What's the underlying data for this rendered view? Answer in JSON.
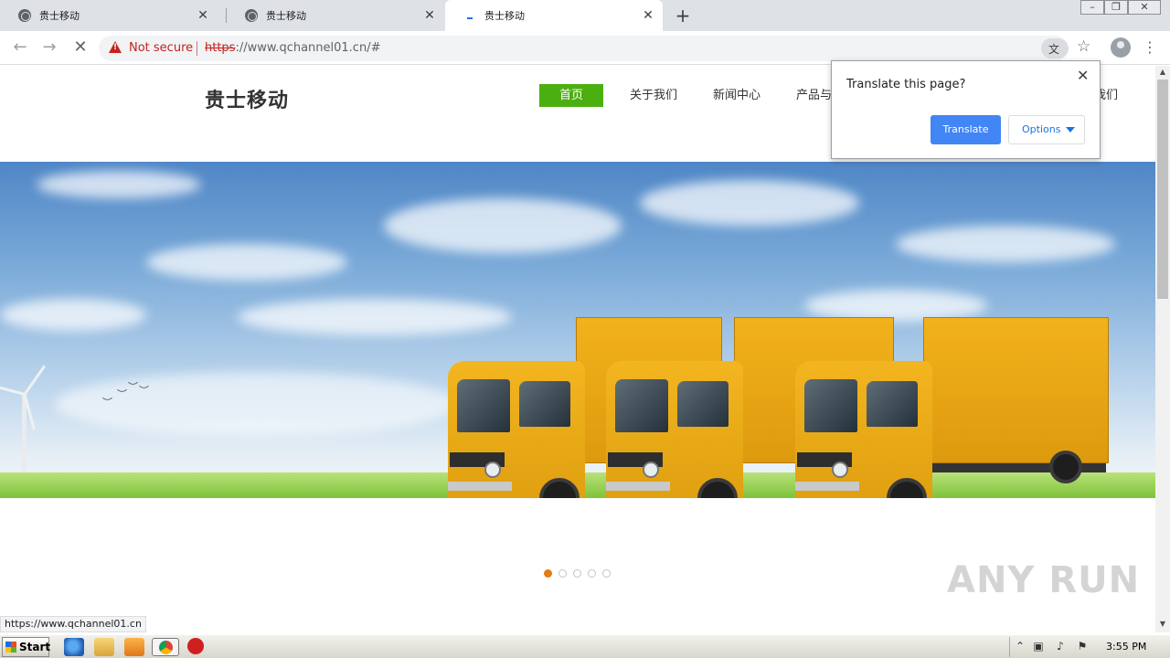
{
  "tabs": [
    {
      "title": "贵士移动",
      "active": false
    },
    {
      "title": "贵士移动",
      "active": false
    },
    {
      "title": "贵士移动",
      "active": true
    }
  ],
  "toolbar": {
    "security_text": "Not secure",
    "url_scheme": "https",
    "url_rest": "://www.qchannel01.cn/#"
  },
  "page": {
    "logo": "贵士移动",
    "nav": [
      "首页",
      "关于我们",
      "新闻中心",
      "产品与",
      "我们"
    ],
    "carousel_dots": 5,
    "carousel_active_index": 0
  },
  "translate_popup": {
    "title": "Translate this page?",
    "translate_label": "Translate",
    "options_label": "Options"
  },
  "status_url": "https://www.qchannel01.cn",
  "watermark": "ANY RUN",
  "taskbar": {
    "start_label": "Start",
    "clock": "3:55 PM"
  },
  "colors": {
    "nav_active": "#4caf10",
    "translate_button": "#4285f4",
    "dot_active": "#e57a0f",
    "not_secure": "#c5221f"
  }
}
